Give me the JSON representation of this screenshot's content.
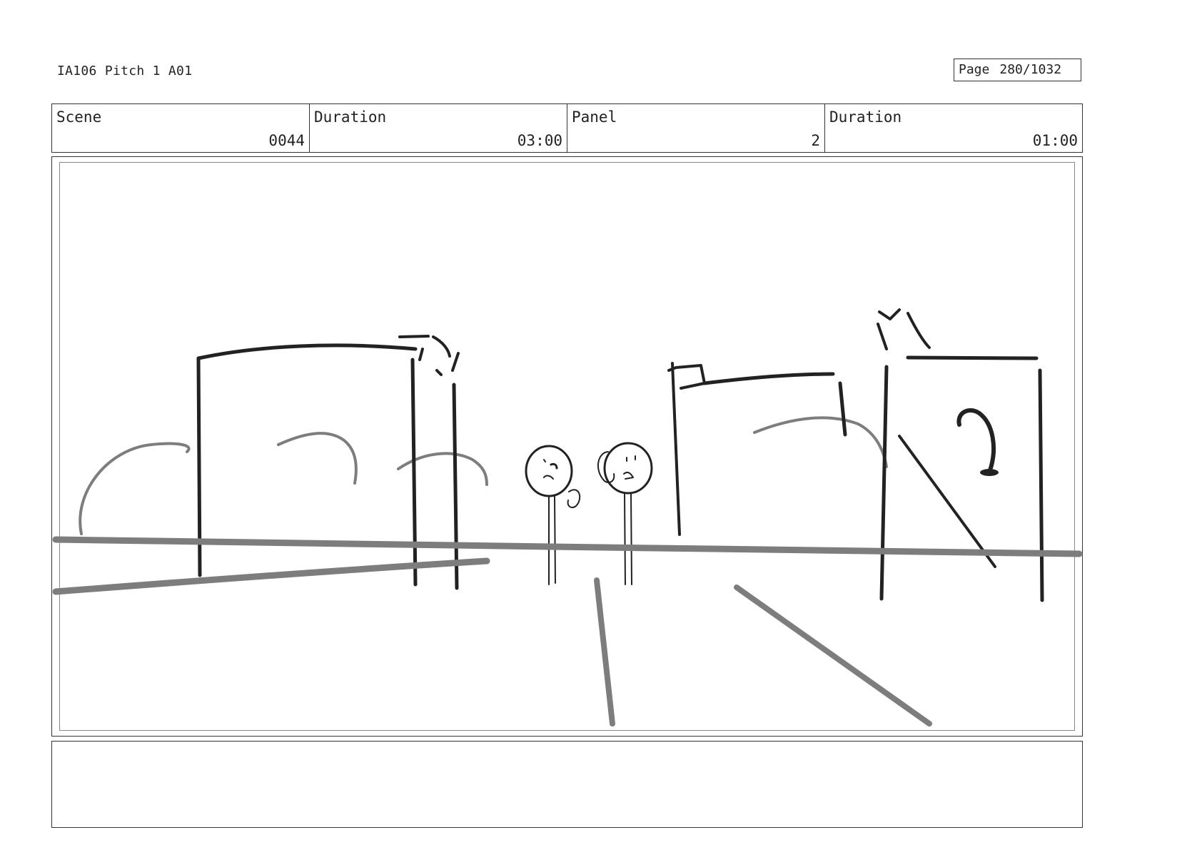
{
  "header": {
    "project_title": "IA106 Pitch 1 A01",
    "page_label": "Page",
    "page_number": "280/1032"
  },
  "info": {
    "scene_label": "Scene",
    "scene_value": "0044",
    "duration_label": "Duration",
    "duration_value": "03:00",
    "panel_label": "Panel",
    "panel_value": "2",
    "panel_duration_label": "Duration",
    "panel_duration_value": "01:00"
  },
  "notes": {
    "text": ""
  },
  "colors": {
    "ink": "#222222",
    "ground_line": "#7d7d7d",
    "frame_border": "#333333"
  }
}
